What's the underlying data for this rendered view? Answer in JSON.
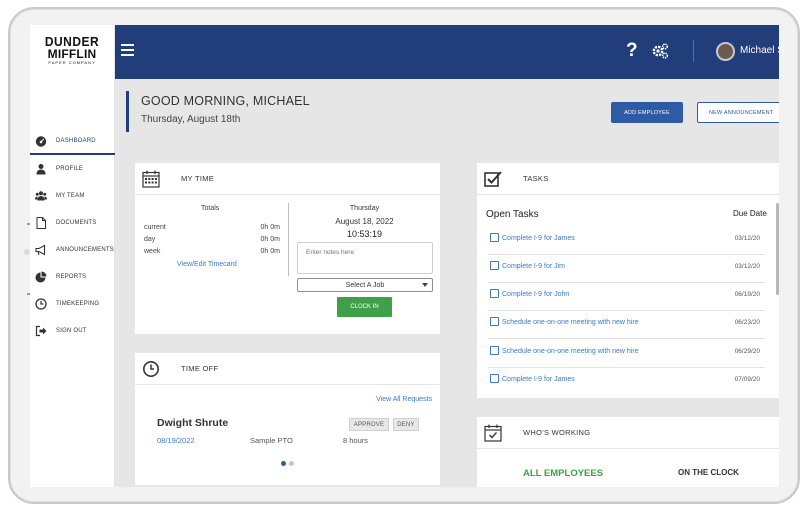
{
  "sidebar": {
    "logo": {
      "line1": "DUNDER",
      "line2": "MIFFLIN",
      "line3": "PAPER COMPANY"
    },
    "items": [
      {
        "label": "DASHBOARD",
        "icon": "dashboard-icon",
        "active": true
      },
      {
        "label": "PROFILE",
        "icon": "person-icon"
      },
      {
        "label": "MY TEAM",
        "icon": "team-icon"
      },
      {
        "label": "DOCUMENTS",
        "icon": "document-icon"
      },
      {
        "label": "ANNOUNCEMENTS",
        "icon": "megaphone-icon"
      },
      {
        "label": "REPORTS",
        "icon": "pie-chart-icon"
      },
      {
        "label": "TIMEKEEPING",
        "icon": "clock-icon"
      },
      {
        "label": "SIGN OUT",
        "icon": "sign-out-icon"
      }
    ]
  },
  "topbar": {
    "help": "?",
    "username": "Michael S"
  },
  "header": {
    "greeting": "GOOD MORNING, MICHAEL",
    "date": "Thursday, August 18th",
    "add_employee": "ADD EMPLOYEE",
    "new_announcement": "NEW ANNOUNCEMENT"
  },
  "my_time": {
    "title": "MY TIME",
    "totals_title": "Totals",
    "totals": [
      {
        "label": "current",
        "value": "0h 0m"
      },
      {
        "label": "day",
        "value": "0h 0m"
      },
      {
        "label": "week",
        "value": "0h 0m"
      }
    ],
    "timecard_link": "View/Edit Timecard",
    "day": "Thursday",
    "date": "August 18, 2022",
    "time": "10:53:19",
    "notes_placeholder": "Enter notes here",
    "job_select": "Select A Job",
    "clock_in": "CLOCK IN"
  },
  "time_off": {
    "title": "TIME OFF",
    "view_all": "View All Requests",
    "request": {
      "name": "Dwight Shrute",
      "date": "08/19/2022",
      "type": "Sample PTO",
      "hours": "8 hours",
      "approve": "APPROVE",
      "deny": "DENY"
    }
  },
  "tasks": {
    "title": "TASKS",
    "open_tasks": "Open Tasks",
    "due_date": "Due Date",
    "items": [
      {
        "label": "Complete I-9 for James",
        "due": "03/12/20"
      },
      {
        "label": "Complete I-9 for Jim",
        "due": "03/12/20"
      },
      {
        "label": "Complete I-9 for John",
        "due": "06/19/20"
      },
      {
        "label": "Schedule one-on-one meeting with new hire",
        "due": "06/23/20"
      },
      {
        "label": "Schedule one-on-one meeting with new hire",
        "due": "06/29/20"
      },
      {
        "label": "Complete I-9 for James",
        "due": "07/09/20"
      }
    ]
  },
  "whos_working": {
    "title": "WHO'S WORKING",
    "all_employees": "ALL EMPLOYEES",
    "on_the_clock": "ON THE CLOCK"
  },
  "colors": {
    "brand": "#223e7a",
    "accent": "#2f5aa6",
    "link": "#3d7ac7",
    "success": "#3fa04a"
  }
}
